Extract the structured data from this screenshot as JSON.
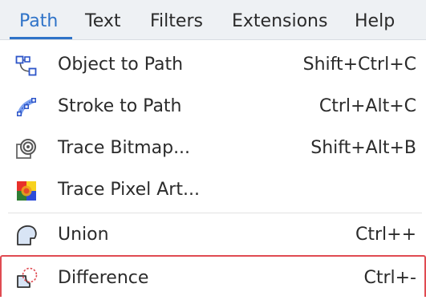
{
  "menubar": {
    "items": [
      {
        "label": "Path",
        "active": true
      },
      {
        "label": "Text"
      },
      {
        "label": "Filters"
      },
      {
        "label": "Extensions"
      },
      {
        "label": "Help"
      }
    ]
  },
  "menu": {
    "items": [
      {
        "label": "Object to Path",
        "shortcut": "Shift+Ctrl+C",
        "icon": "object-to-path-icon"
      },
      {
        "label": "Stroke to Path",
        "shortcut": "Ctrl+Alt+C",
        "icon": "stroke-to-path-icon"
      },
      {
        "label": "Trace Bitmap...",
        "shortcut": "Shift+Alt+B",
        "icon": "trace-bitmap-icon"
      },
      {
        "label": "Trace Pixel Art...",
        "shortcut": "",
        "icon": "trace-pixel-art-icon"
      },
      {
        "label": "Union",
        "shortcut": "Ctrl++",
        "icon": "union-icon"
      },
      {
        "label": "Difference",
        "shortcut": "Ctrl+-",
        "icon": "difference-icon",
        "highlighted": true
      }
    ]
  },
  "colors": {
    "accent": "#2f73c8",
    "highlight_border": "#e04b52",
    "menubar_bg": "#eef1f4"
  }
}
